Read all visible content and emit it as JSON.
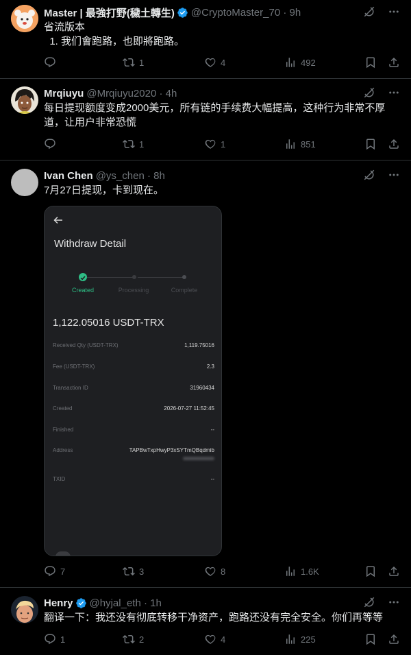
{
  "tweets": [
    {
      "name": "Master | 最強打野(穢土轉生)",
      "handle": "@CryptoMaster_70 · 9h",
      "verified": true,
      "text_lines": [
        "省流版本",
        "  1. 我们會跑路，也即將跑路。"
      ],
      "replies": "",
      "reposts": "1",
      "likes": "4",
      "views": "492"
    },
    {
      "name": "Mrqiuyu",
      "handle": "@Mrqiuyu2020 · 4h",
      "verified": false,
      "text_lines": [
        "每日提现额度变成2000美元，所有链的手续费大幅提高，这种行为非常不厚",
        "道，让用户非常恐慌"
      ],
      "replies": "",
      "reposts": "1",
      "likes": "1",
      "views": "851"
    },
    {
      "name": "Ivan Chen",
      "handle": "@ys_chen · 8h",
      "verified": false,
      "text_lines": [
        "7月27日提现，卡到现在。"
      ],
      "replies": "7",
      "reposts": "3",
      "likes": "8",
      "views": "1.6K"
    },
    {
      "name": "Henry",
      "handle": "@hyjal_eth · 1h",
      "verified": true,
      "text_lines": [
        "翻译一下：我还没有彻底转移干净资产，跑路还没有完全安全。你们再等等"
      ],
      "replies": "1",
      "reposts": "2",
      "likes": "4",
      "views": "225"
    }
  ],
  "media": {
    "title": "Withdraw Detail",
    "steps": [
      "Created",
      "Processing",
      "Complete"
    ],
    "amount": "1,122.05016 USDT-TRX",
    "rows": [
      {
        "k": "Received Qty (USDT-TRX)",
        "v": "1,119.75016"
      },
      {
        "k": "Fee (USDT-TRX)",
        "v": "2.3"
      },
      {
        "k": "Transaction ID",
        "v": "31960434"
      },
      {
        "k": "Created",
        "v": "2026-07-27 11:52:45"
      },
      {
        "k": "Finished",
        "v": "--"
      },
      {
        "k": "Address",
        "v": "TAPBwTxpHwyP3xSYTmQBqdmib"
      },
      {
        "k": "TXID",
        "v": "--"
      }
    ]
  },
  "colors": {
    "background": "#000000",
    "text": "#e7e9ea",
    "muted": "#71767b",
    "divider": "#2f3336",
    "verified": "#1d9bf0",
    "step_active": "#2ebd85"
  },
  "icons": [
    "grok-icon",
    "more-icon",
    "reply-icon",
    "repost-icon",
    "like-icon",
    "views-icon",
    "bookmark-icon",
    "share-icon",
    "verified-badge-icon",
    "back-arrow-icon",
    "check-icon"
  ]
}
